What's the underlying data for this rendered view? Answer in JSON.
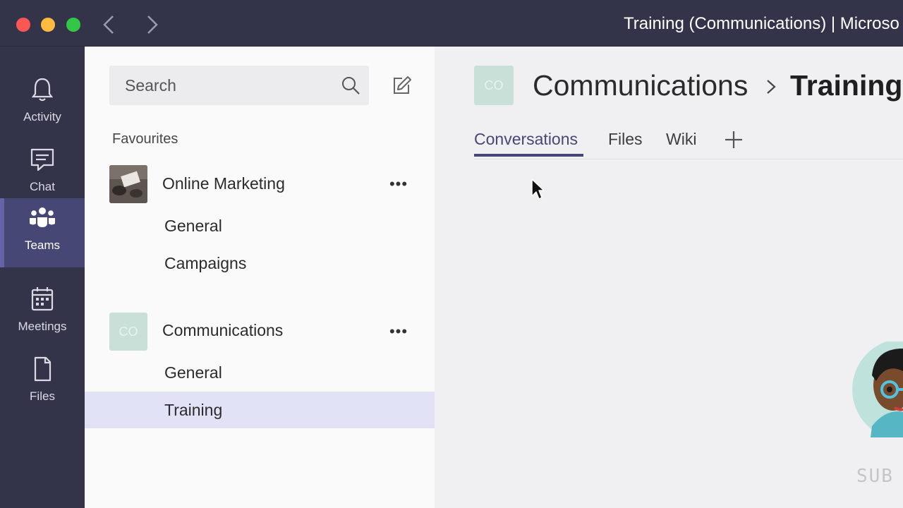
{
  "window": {
    "title": "Training (Communications) | Microso"
  },
  "rail": {
    "items": [
      {
        "label": "Activity",
        "icon": "bell-icon"
      },
      {
        "label": "Chat",
        "icon": "chat-icon"
      },
      {
        "label": "Teams",
        "icon": "teams-icon",
        "active": true
      },
      {
        "label": "Meetings",
        "icon": "calendar-icon"
      },
      {
        "label": "Files",
        "icon": "file-icon"
      }
    ]
  },
  "sidebar": {
    "search_placeholder": "Search",
    "section_label": "Favourites",
    "teams": [
      {
        "name": "Online Marketing",
        "avatar": "photo",
        "more": "•••",
        "channels": [
          "General",
          "Campaigns"
        ]
      },
      {
        "name": "Communications",
        "avatar_text": "CO",
        "more": "•••",
        "channels": [
          "General",
          "Training"
        ],
        "selected_channel": "Training"
      }
    ]
  },
  "main": {
    "avatar_text": "CO",
    "breadcrumb": {
      "team": "Communications",
      "channel": "Training"
    },
    "tabs": [
      {
        "label": "Conversations",
        "active": true
      },
      {
        "label": "Files"
      },
      {
        "label": "Wiki"
      }
    ],
    "watermark": "SUB"
  },
  "colors": {
    "rail_bg": "#33344a",
    "accent": "#464775",
    "selected_channel_bg": "#e2e2f6",
    "team_avatar_bg": "#c9e0d8"
  }
}
